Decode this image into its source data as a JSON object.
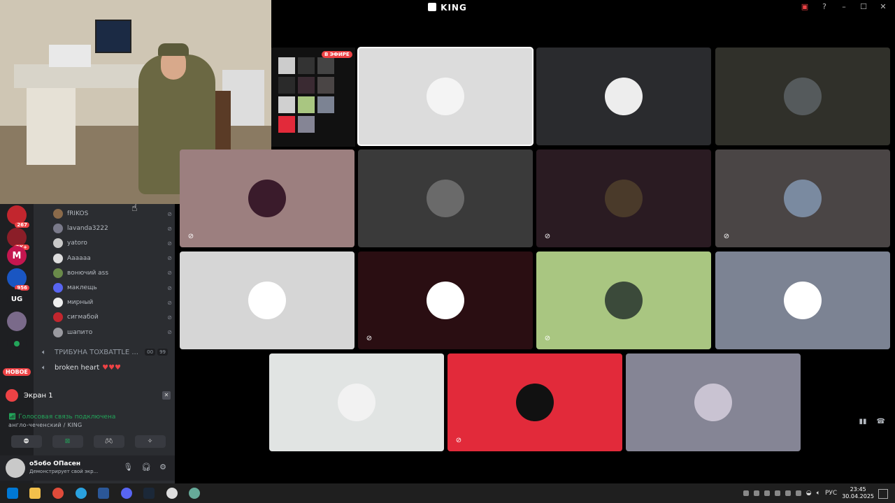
{
  "window": {
    "title": "KING",
    "controls": [
      "screen-share",
      "help",
      "minimize",
      "maximize",
      "close"
    ]
  },
  "stream_preview": {
    "live_badge": "В ЭФИРЕ"
  },
  "servers": [
    {
      "badge": "267"
    },
    {
      "badge": "2K+"
    },
    {
      "label": "M"
    },
    {
      "badge": "956"
    },
    {
      "label": "UG"
    },
    {
      "label": ""
    },
    {
      "label": ""
    }
  ],
  "servers_new_badge": "НОВОЕ",
  "members": [
    {
      "name": "fRIKOS"
    },
    {
      "name": "lavanda3222"
    },
    {
      "name": "yatoro"
    },
    {
      "name": "Аааааа"
    },
    {
      "name": "вонючий ass"
    },
    {
      "name": "маклещь"
    },
    {
      "name": "мирный"
    },
    {
      "name": "сигмабой"
    },
    {
      "name": "шапито"
    }
  ],
  "voice_channels": [
    {
      "name": "ТРИБУНА TOXBATTLE ...",
      "count_a": "00",
      "count_b": "99"
    },
    {
      "name": "broken heart",
      "hearts": "♥♥♥"
    }
  ],
  "screen_share": {
    "label": "Экран 1"
  },
  "voice_connection": {
    "status": "Голосовая связь подключена",
    "channel": "англо-чеченский / KING"
  },
  "user_panel": {
    "name": "о5о6о ОПасен",
    "status": "Демонстрирует свой экр..."
  },
  "tiles": [
    {
      "bg": "#dcdcdc",
      "avatar_color": "#f4f4f4",
      "mic_off": false
    },
    {
      "bg": "#2a2b2e",
      "avatar_color": "#ededed",
      "mic_off": false
    },
    {
      "bg": "#30302a",
      "avatar_color": "#555a5c",
      "mic_off": false
    },
    {
      "bg": "#9c7f7f",
      "avatar_color": "#3a1b2b",
      "mic_off": true
    },
    {
      "bg": "#3a3a3a",
      "avatar_color": "#6a6a6a",
      "mic_off": false
    },
    {
      "bg": "#2a1b22",
      "avatar_color": "#4a3a2a",
      "mic_off": true
    },
    {
      "bg": "#4a4545",
      "avatar_color": "#7a8aa0",
      "mic_off": true
    },
    {
      "bg": "#d6d6d6",
      "avatar_color": "#ffffff",
      "mic_off": false
    },
    {
      "bg": "#2a0e12",
      "avatar_color": "#ffffff",
      "mic_off": true
    },
    {
      "bg": "#a9c681",
      "avatar_color": "#3b4a3a",
      "mic_off": true
    },
    {
      "bg": "#7c8393",
      "avatar_color": "#ffffff",
      "mic_off": false
    },
    {
      "bg": "#e1e4e3",
      "avatar_color": "#f2f2f2",
      "mic_off": false
    },
    {
      "bg": "#e22a3a",
      "avatar_color": "#111111",
      "mic_off": true
    },
    {
      "bg": "#858595",
      "avatar_color": "#c9c3d2",
      "mic_off": false
    }
  ],
  "taskbar": {
    "lang": "РУС",
    "time": "23:45",
    "date": "30.04.2025"
  }
}
